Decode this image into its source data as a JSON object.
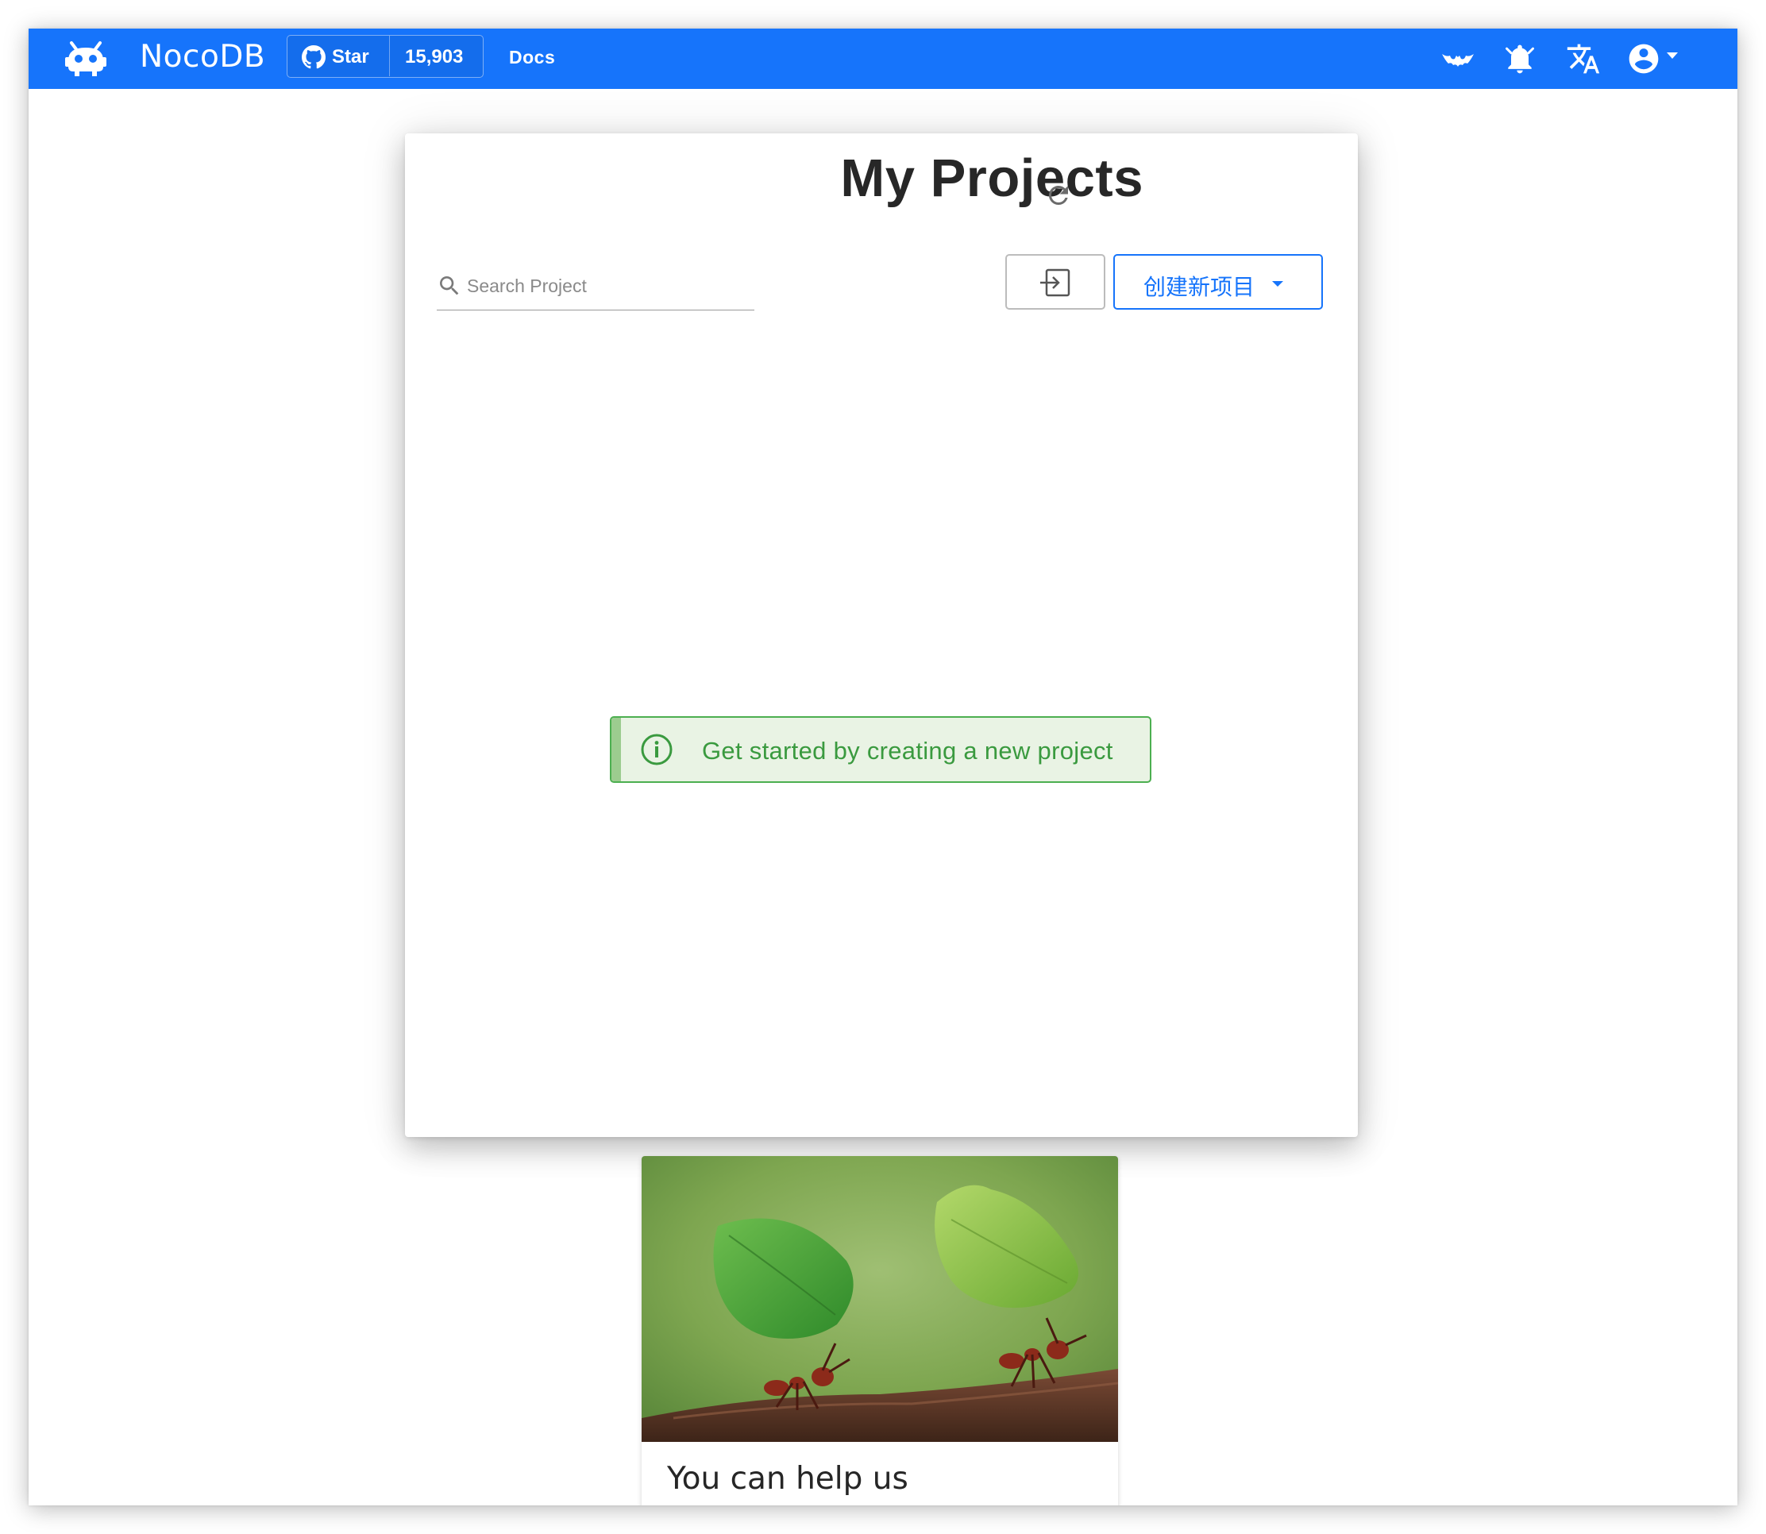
{
  "topbar": {
    "brand": "NocoDB",
    "github": {
      "star_label": "Star",
      "star_count": "15,903"
    },
    "docs_label": "Docs",
    "icons": [
      "bat-icon",
      "bell-icon",
      "translate-icon",
      "account-circle-icon"
    ],
    "color": "#1674fb"
  },
  "projects": {
    "title": "My Projects",
    "search_placeholder": "Search Project",
    "create_button": "创建新项目",
    "empty_message": "Get started by creating a new project"
  },
  "promo": {
    "title": "You can help us"
  },
  "colors": {
    "accent": "#1674fb",
    "success": "#4caf50",
    "success_text": "#3a9a3f",
    "success_bg": "#e9f3e4"
  }
}
